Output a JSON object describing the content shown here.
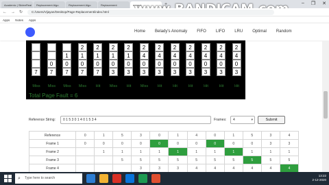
{
  "browser": {
    "tabs": [
      "Academic | SlideeReal",
      "Replacement Algo",
      "Replacement Algo",
      "Replacement",
      "ecosys"
    ],
    "new_tab": "+",
    "url": "C:/Users/Vijayan/Desktop/Page-Replacement/index.html",
    "bookmarks": [
      "Apps",
      "Notes",
      "Apps"
    ],
    "window_controls": [
      "–",
      "❐",
      "✕"
    ]
  },
  "watermark": "www.BANDICAM.com",
  "site": {
    "nav": [
      "Home",
      "Belady's Anomaly",
      "FIFO",
      "LIFO",
      "LRU",
      "Optimal",
      "Random"
    ]
  },
  "visualization": {
    "columns": [
      {
        "frames": [
          "",
          "",
          "",
          "7"
        ],
        "status": "Miss"
      },
      {
        "frames": [
          "",
          "",
          "0",
          "7"
        ],
        "status": "Miss"
      },
      {
        "frames": [
          "",
          "1",
          "0",
          "7"
        ],
        "status": "Miss"
      },
      {
        "frames": [
          "2",
          "1",
          "0",
          "7"
        ],
        "status": "Miss"
      },
      {
        "frames": [
          "2",
          "1",
          "0",
          "7"
        ],
        "status": "Hit"
      },
      {
        "frames": [
          "2",
          "1",
          "0",
          "3"
        ],
        "status": "Miss"
      },
      {
        "frames": [
          "2",
          "1",
          "0",
          "3"
        ],
        "status": "Hit"
      },
      {
        "frames": [
          "2",
          "4",
          "0",
          "3"
        ],
        "status": "Miss"
      },
      {
        "frames": [
          "2",
          "4",
          "0",
          "3"
        ],
        "status": "Hit"
      },
      {
        "frames": [
          "2",
          "4",
          "0",
          "3"
        ],
        "status": "Hit"
      },
      {
        "frames": [
          "2",
          "4",
          "0",
          "3"
        ],
        "status": "Hit"
      },
      {
        "frames": [
          "2",
          "4",
          "0",
          "3"
        ],
        "status": "Hit"
      },
      {
        "frames": [
          "2",
          "4",
          "0",
          "3"
        ],
        "status": "Hit"
      },
      {
        "frames": [
          "2",
          "4",
          "0",
          "3"
        ],
        "status": "Hit"
      }
    ],
    "fault_text": "Total Page Fault = 6"
  },
  "controls": {
    "reference_label": "Reference String:",
    "reference_value": "0 1 5 3 0 1 4 0 1 5 3 4",
    "frames_label": "Frames:",
    "frames_value": "4",
    "submit_label": "Submit"
  },
  "table": {
    "header_label": "Reference",
    "references": [
      "0",
      "1",
      "5",
      "3",
      "0",
      "1",
      "4",
      "0",
      "1",
      "5",
      "3",
      "4"
    ],
    "rows": [
      {
        "label": "Frame 1",
        "cells": [
          "0",
          "0",
          "0",
          "0",
          "0",
          "0",
          "0",
          "0",
          "0",
          "0",
          "3",
          "3"
        ],
        "hits": [
          4,
          7
        ]
      },
      {
        "label": "Frame 2",
        "cells": [
          "",
          "1",
          "1",
          "1",
          "1",
          "1",
          "1",
          "1",
          "1",
          "1",
          "1",
          "1"
        ],
        "hits": [
          5,
          8
        ]
      },
      {
        "label": "Frame 3",
        "cells": [
          "",
          "",
          "5",
          "5",
          "5",
          "5",
          "5",
          "5",
          "5",
          "5",
          "5",
          "5"
        ],
        "hits": [
          9
        ]
      },
      {
        "label": "Frame 4",
        "cells": [
          "",
          "",
          "",
          "3",
          "3",
          "3",
          "4",
          "4",
          "4",
          "4",
          "4",
          "4"
        ],
        "hits": [
          11
        ]
      }
    ]
  },
  "taskbar": {
    "search_placeholder": "Type here to search",
    "time": "13:22",
    "date": "2-12-2020"
  }
}
